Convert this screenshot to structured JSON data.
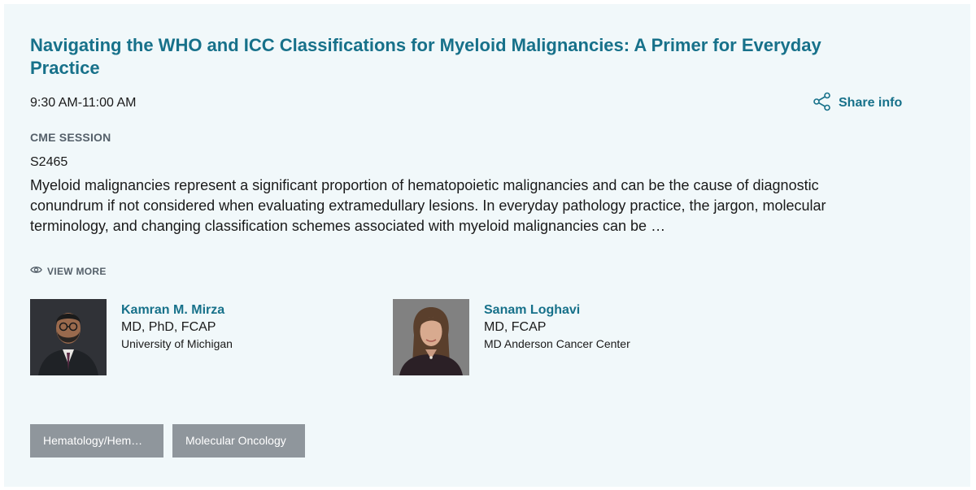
{
  "session": {
    "title": "Navigating the WHO and ICC Classifications for Myeloid Malignancies: A Primer for Everyday Practice",
    "time": "9:30 AM-11:00 AM",
    "share_label": "Share info",
    "type_label": "CME SESSION",
    "code": "S2465",
    "description": "Myeloid malignancies represent a significant proportion of hematopoietic malignancies and can be the cause of diagnostic conundrum if not considered when evaluating extramedullary lesions. In everyday pathology practice, the jargon, molecular terminology, and changing classification schemes associated with myeloid malignancies can be …",
    "view_more_label": "VIEW MORE"
  },
  "speakers": [
    {
      "name": "Kamran M. Mirza",
      "credentials": "MD, PhD, FCAP",
      "organization": "University of Michigan"
    },
    {
      "name": "Sanam Loghavi",
      "credentials": "MD, FCAP",
      "organization": "MD Anderson Cancer Center"
    }
  ],
  "tags": [
    {
      "label": "Hematology/Hem…"
    },
    {
      "label": "Molecular Oncology"
    }
  ],
  "colors": {
    "accent": "#17718a",
    "card_background": "#f1f8fa",
    "tag_background": "#8f969c",
    "muted_text": "#55606a"
  },
  "icons": {
    "share": "share-nodes-icon",
    "view_more": "eye-icon"
  }
}
